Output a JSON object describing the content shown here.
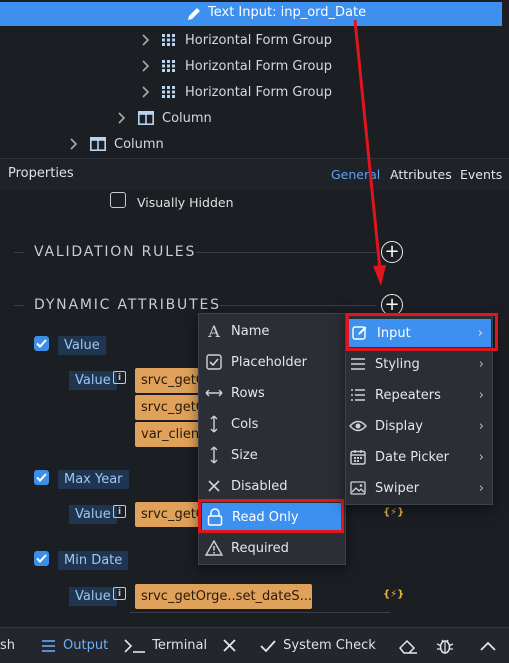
{
  "tree": {
    "selected_label": "Text Input: inp_ord_Date",
    "rows": [
      {
        "label": "Horizontal Form Group"
      },
      {
        "label": "Horizontal Form Group"
      },
      {
        "label": "Horizontal Form Group"
      },
      {
        "label": "Column"
      },
      {
        "label": "Column"
      }
    ]
  },
  "properties": {
    "title": "Properties",
    "tabs": [
      "General",
      "Attributes",
      "Events"
    ],
    "active_tab": "General",
    "visually_hidden_label": "Visually Hidden"
  },
  "sections": {
    "validation": "VALIDATION RULES",
    "dynamic": "DYNAMIC ATTRIBUTES"
  },
  "attributes": [
    {
      "label": "Value",
      "sublabel": "Value",
      "bindings": [
        "srvc_getO",
        "srvc_getO",
        "var_client"
      ]
    },
    {
      "label": "Max Year",
      "sublabel": "Value",
      "bindings": [
        "srvc_getO"
      ]
    },
    {
      "label": "Min Date",
      "sublabel": "Value",
      "bindings": [
        "srvc_getOrge..set_dateS..."
      ]
    }
  ],
  "dynamic_icon": "{⚡}",
  "left_menu": {
    "items": [
      {
        "label": "Name",
        "icon": "font-icon"
      },
      {
        "label": "Placeholder",
        "icon": "checkbox-icon"
      },
      {
        "label": "Rows",
        "icon": "arrows-horizontal-icon"
      },
      {
        "label": "Cols",
        "icon": "arrows-vertical-icon"
      },
      {
        "label": "Size",
        "icon": "arrows-vertical-icon"
      },
      {
        "label": "Disabled",
        "icon": "x-icon"
      },
      {
        "label": "Read Only",
        "icon": "lock-icon"
      },
      {
        "label": "Required",
        "icon": "warning-icon"
      }
    ],
    "highlighted": "Read Only"
  },
  "right_menu": {
    "items": [
      {
        "label": "Input",
        "icon": "edit-icon"
      },
      {
        "label": "Styling",
        "icon": "lines-icon"
      },
      {
        "label": "Repeaters",
        "icon": "list-icon"
      },
      {
        "label": "Display",
        "icon": "eye-icon"
      },
      {
        "label": "Date Picker",
        "icon": "calendar-icon"
      },
      {
        "label": "Swiper",
        "icon": "image-icon"
      }
    ],
    "highlighted": "Input"
  },
  "bottombar": {
    "items": [
      {
        "label": "sh"
      },
      {
        "label": "Output"
      },
      {
        "label": "Terminal"
      },
      {
        "label": ""
      },
      {
        "label": "System Check"
      }
    ]
  },
  "colors": {
    "accent": "#3d8ff0",
    "highlight_box": "#e0161e",
    "binding": "#e0a25a"
  }
}
